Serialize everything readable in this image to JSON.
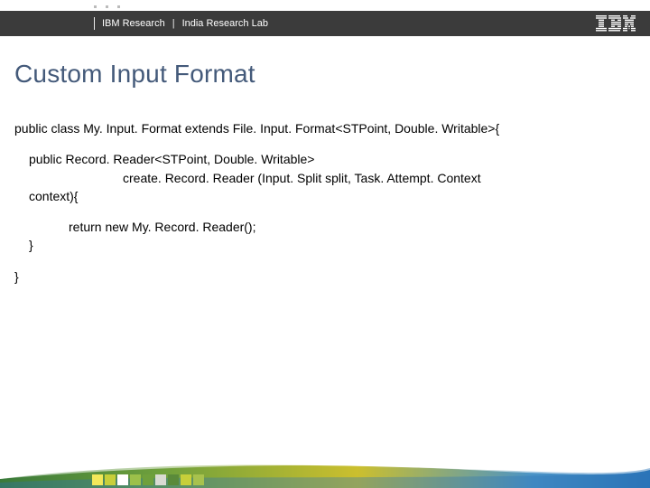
{
  "header": {
    "org": "IBM Research",
    "separator": "|",
    "lab": "India Research Lab",
    "logo_name": "ibm-logo"
  },
  "title": "Custom Input Format",
  "code": {
    "line1": "public class My. Input. Format extends File. Input. Format<STPoint, Double. Writable>{",
    "line2": "public Record. Reader<STPoint, Double. Writable>",
    "line3": "create. Record. Reader (Input. Split split, Task. Attempt. Context",
    "line4": "context){",
    "line5": "return new My. Record. Reader();",
    "line6": "}",
    "line7": "}"
  },
  "footer": {
    "colors": {
      "gradient_start": "#3a7a3a",
      "gradient_mid1": "#6fa03c",
      "gradient_mid2": "#cbbf2e",
      "gradient_end": "#2a74b8"
    },
    "mosaic": [
      "#f2e85a",
      "#c7cf3a",
      "#ffffff",
      "#9cc04a",
      "#6fa03c",
      "#d9dbd2",
      "#5a8a3a",
      "#c7cf3a",
      "#a8c24d"
    ]
  }
}
